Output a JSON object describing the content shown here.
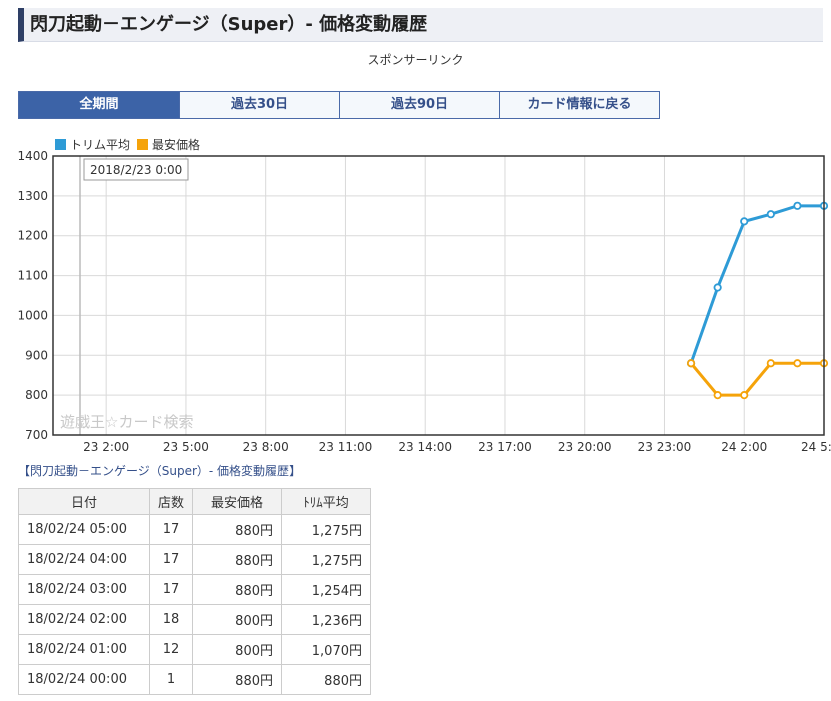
{
  "page": {
    "title": "閃刀起動－エンゲージ（Super）- 価格変動履歴",
    "sponsor": "スポンサーリンク",
    "tabs": [
      "全期間",
      "過去30日",
      "過去90日",
      "カード情報に戻る"
    ],
    "caption": "【閃刀起動－エンゲージ（Super）- 価格変動履歴】",
    "watermark": "遊戯王☆カード検索",
    "tooltip": "2018/2/23 0:00"
  },
  "colors": {
    "trim": "#2e9bd6",
    "low": "#f5a30a",
    "active_tab": "#3c63a7"
  },
  "chart_data": {
    "type": "line",
    "legend": [
      "トリム平均",
      "最安価格"
    ],
    "y_ticks": [
      "1400",
      "1300",
      "1200",
      "1100",
      "1000",
      "900",
      "800",
      "700"
    ],
    "ylim": [
      700,
      1400
    ],
    "x_ticks": [
      "23 2:00",
      "23 5:00",
      "23 8:00",
      "23 11:00",
      "23 14:00",
      "23 17:00",
      "23 20:00",
      "23 23:00",
      "24 2:00",
      "24 5:00"
    ],
    "x_tick_hours": [
      2,
      5,
      8,
      11,
      14,
      17,
      20,
      23,
      26,
      29
    ],
    "x_range_hours": [
      0,
      29
    ],
    "x_hours": [
      24,
      25,
      26,
      27,
      28,
      29
    ],
    "series": [
      {
        "name": "トリム平均",
        "values": [
          880,
          1070,
          1236,
          1254,
          1275,
          1275
        ]
      },
      {
        "name": "最安価格",
        "values": [
          880,
          800,
          800,
          880,
          880,
          880
        ]
      }
    ]
  },
  "table": {
    "headers": [
      "日付",
      "店数",
      "最安価格",
      "ﾄﾘﾑ平均"
    ],
    "rows": [
      [
        "18/02/24 05:00",
        "17",
        "880円",
        "1,275円"
      ],
      [
        "18/02/24 04:00",
        "17",
        "880円",
        "1,275円"
      ],
      [
        "18/02/24 03:00",
        "17",
        "880円",
        "1,254円"
      ],
      [
        "18/02/24 02:00",
        "18",
        "800円",
        "1,236円"
      ],
      [
        "18/02/24 01:00",
        "12",
        "800円",
        "1,070円"
      ],
      [
        "18/02/24 00:00",
        "1",
        "880円",
        "880円"
      ]
    ]
  }
}
